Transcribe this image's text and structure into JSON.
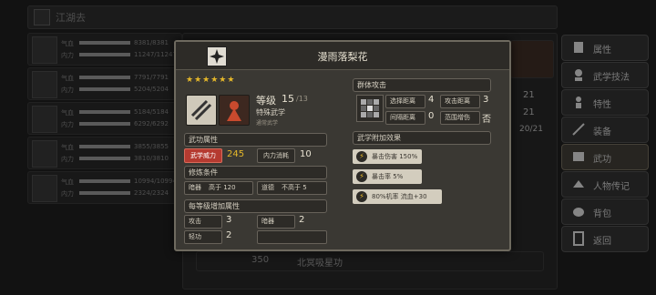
{
  "background": {
    "topbar_title": "江湖去",
    "characters": [
      {
        "hp_label": "气血",
        "mp_label": "内力",
        "hp": "8381/8381",
        "mp": "11247/11247"
      },
      {
        "hp_label": "气血",
        "mp_label": "内力",
        "hp": "7791/7791",
        "mp": "5204/5204"
      },
      {
        "hp_label": "气血",
        "mp_label": "内力",
        "hp": "5184/5184",
        "mp": "6292/6292"
      },
      {
        "hp_label": "气血",
        "mp_label": "内力",
        "hp": "3855/3855",
        "mp": "3810/3810"
      },
      {
        "hp_label": "气血",
        "mp_label": "内力",
        "hp": "10994/10994",
        "mp": "2324/2324"
      }
    ],
    "side_menu": [
      {
        "label": "属性",
        "icon": "attributes-icon"
      },
      {
        "label": "武学技法",
        "icon": "martial-arts-icon"
      },
      {
        "label": "特性",
        "icon": "traits-icon"
      },
      {
        "label": "装备",
        "icon": "equipment-icon"
      },
      {
        "label": "武功",
        "icon": "kungfu-icon"
      },
      {
        "label": "人物传记",
        "icon": "biography-icon"
      },
      {
        "label": "背包",
        "icon": "backpack-icon"
      },
      {
        "label": "返回",
        "icon": "return-icon"
      }
    ],
    "side_numbers": [
      "21",
      "21",
      "20/21"
    ],
    "bottom_cost": "350",
    "bottom_name": "北冥吸星功"
  },
  "popup": {
    "title": "漫雨落梨花",
    "stars": "★★★★★★",
    "level_label": "等级",
    "level": "15",
    "level_max": "/13",
    "type": "特殊武学",
    "subtype": "通常武学",
    "attr_title": "武功属性",
    "power_label": "武学威力",
    "power_value": "245",
    "cost_label": "内力消耗",
    "cost_value": "10",
    "practice_title": "修炼条件",
    "practice_fields": [
      {
        "k": "暗器",
        "v": "高于 120"
      },
      {
        "k": "道德",
        "v": "不高于 5"
      }
    ],
    "per_level_title": "每等级增加属性",
    "per_level_fields": [
      {
        "k": "攻击",
        "v": "3"
      },
      {
        "k": "暗器",
        "v": "2"
      },
      {
        "k": "轻功",
        "v": "2"
      },
      {
        "k": "",
        "v": ""
      }
    ],
    "aoe_title": "群体攻击",
    "aoe_fields": [
      {
        "k": "选择距离",
        "v": "4"
      },
      {
        "k": "攻击距离",
        "v": "3"
      },
      {
        "k": "间隔距离",
        "v": "0"
      },
      {
        "k": "范围增伤",
        "v": "否"
      }
    ],
    "effects_title": "武学附加效果",
    "effects": [
      "暴击伤害 150%",
      "暴击率 5%",
      "80%机率 流血+30"
    ]
  },
  "colors": {
    "accent": "#e6b82a",
    "red": "#b53a30",
    "panel": "#3a3833"
  }
}
